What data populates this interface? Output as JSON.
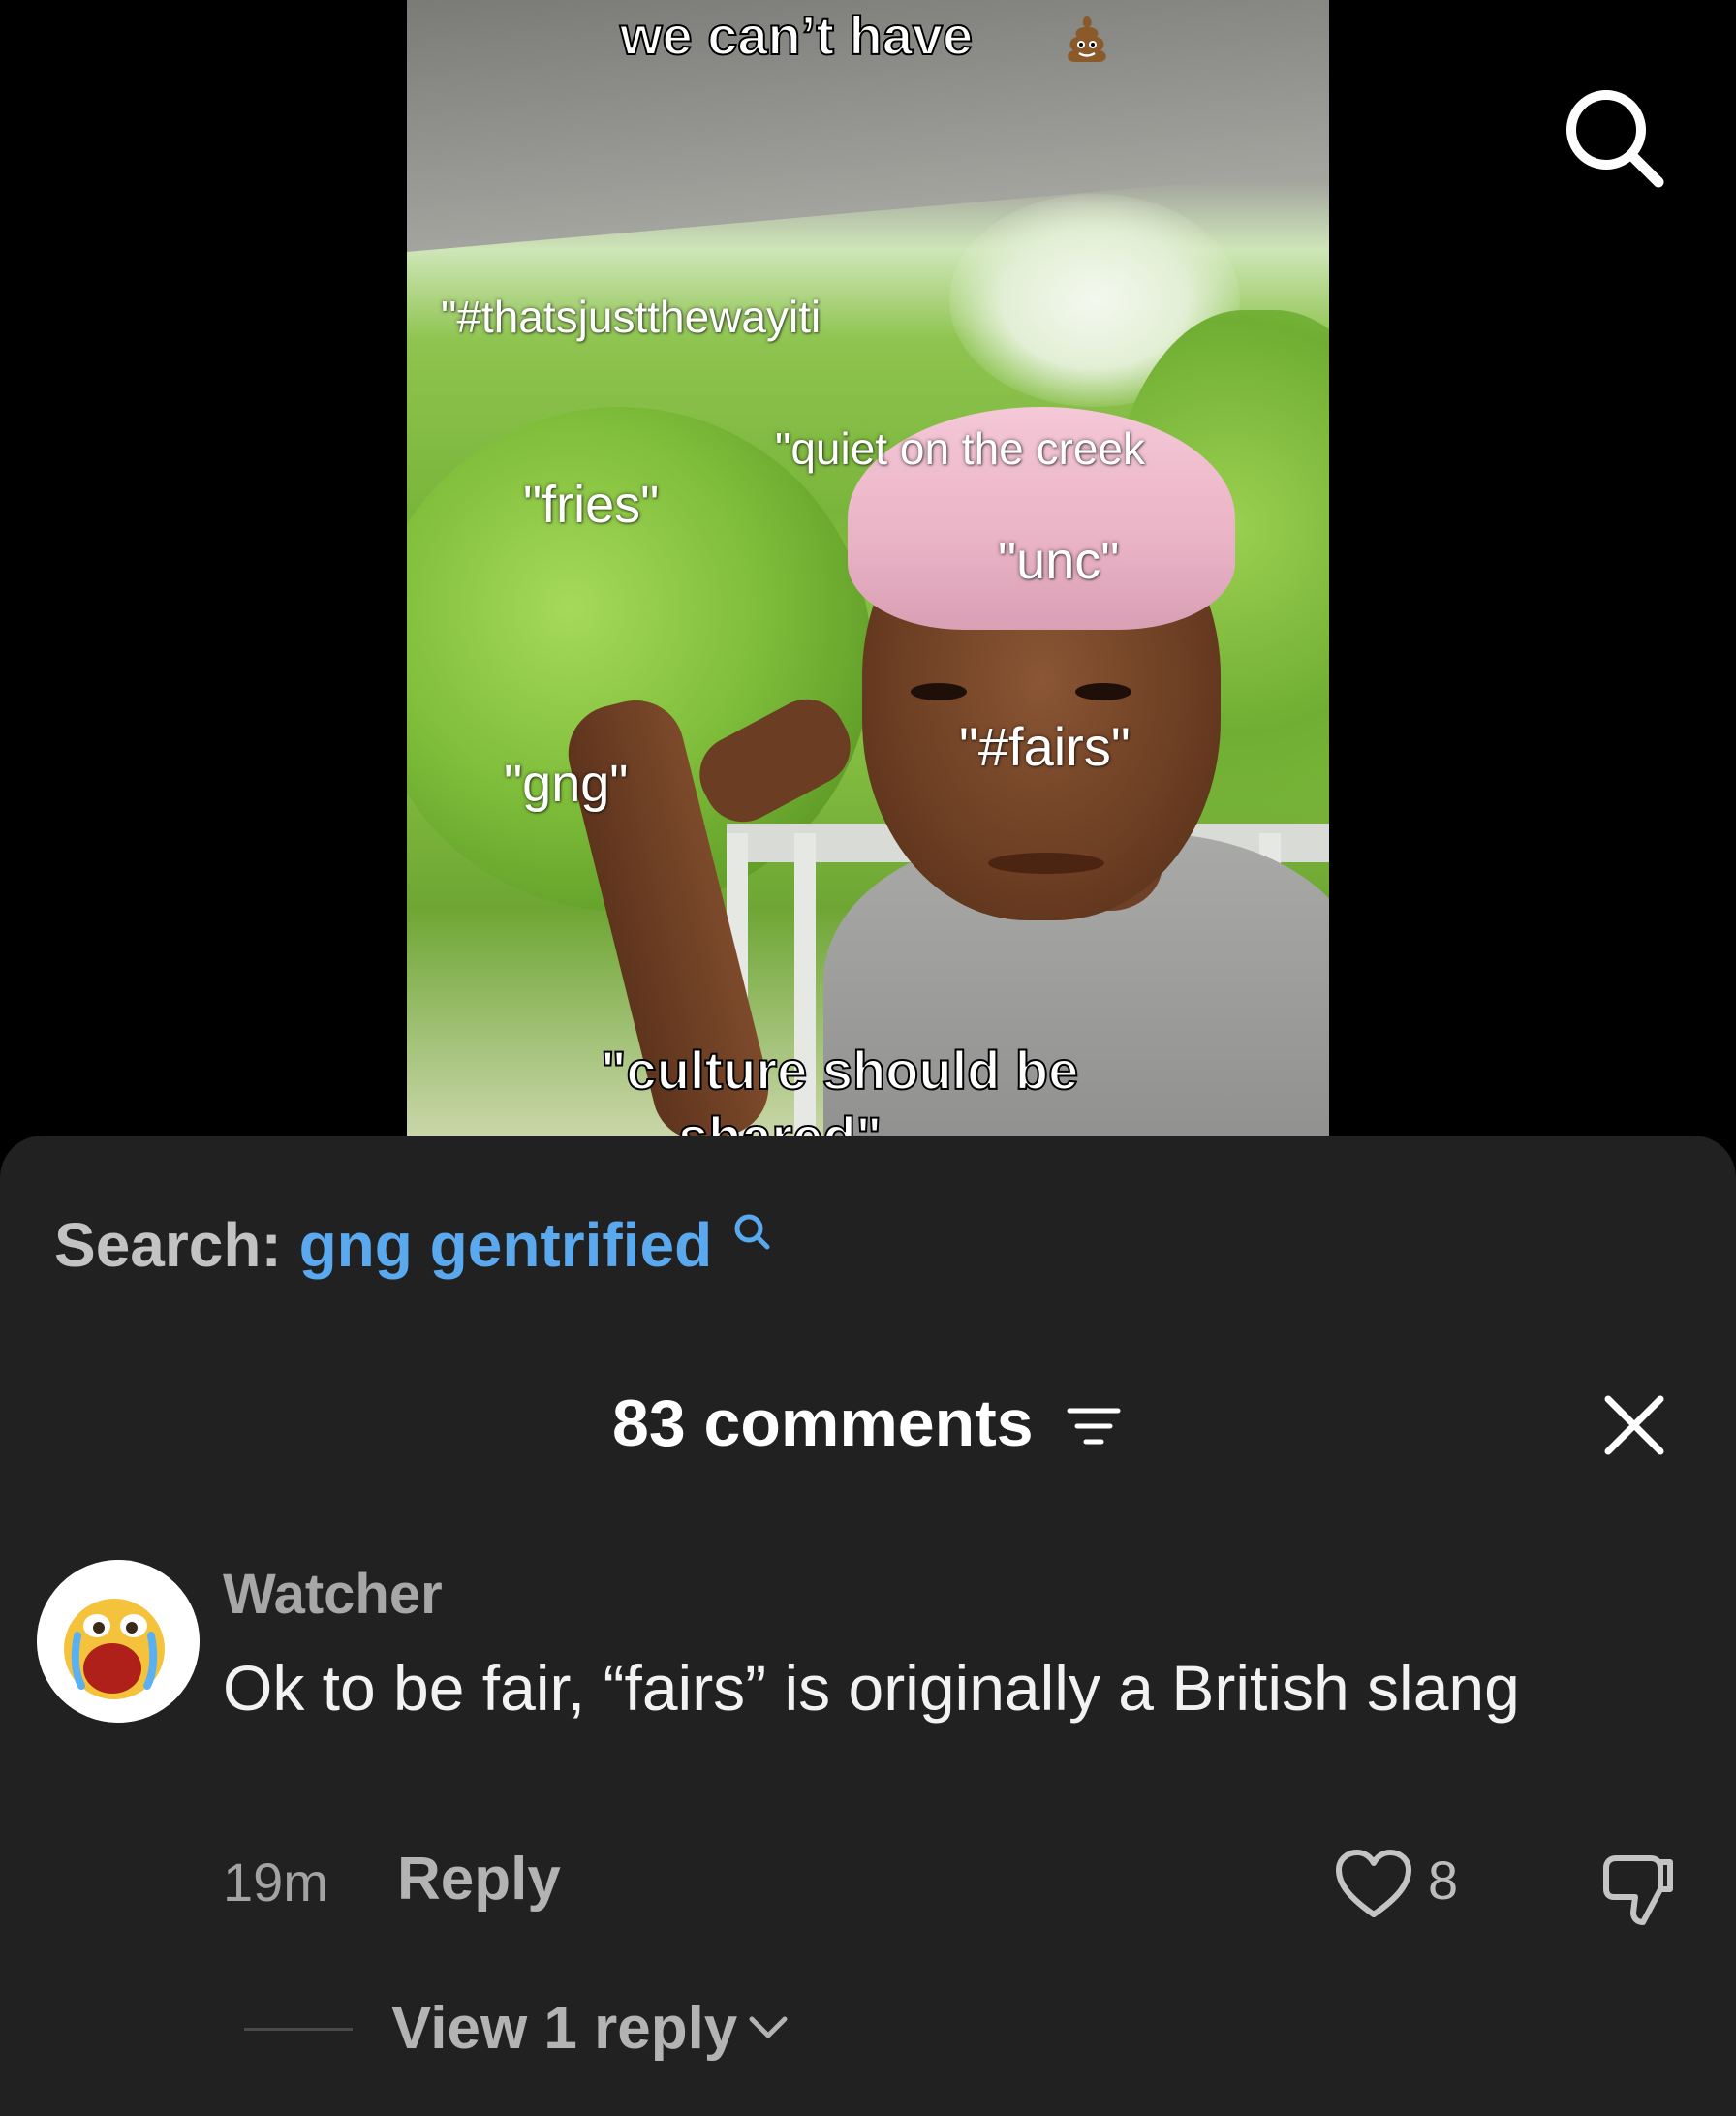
{
  "video": {
    "caption_top": "we can’t have",
    "overlay_words": [
      "\"#thatsjustthewayiti",
      "\"quiet on the creek",
      "\"fries\"",
      "\"unc\"",
      "\"#fairs\"",
      "\"gng\""
    ],
    "caption_bottom_line1": "\"culture should be",
    "caption_bottom_line2": "shared\""
  },
  "top_bar": {
    "search_icon": "search-icon"
  },
  "search_suggestion": {
    "label": "Search:",
    "query": "gng gentrified",
    "icon": "search-icon",
    "accent_color": "#5aa8ee"
  },
  "comments_header": {
    "count_label": "83 comments",
    "sort_icon": "filter-lines-icon",
    "close_icon": "close-icon"
  },
  "comments": [
    {
      "username": "Watcher",
      "avatar_icon": "crying-emoji-avatar",
      "text": "Ok to be fair, “fairs” is originally a British slang",
      "time": "19m",
      "reply_label": "Reply",
      "like_count": "8",
      "like_icon": "heart-icon",
      "dislike_icon": "thumbs-down-icon",
      "view_replies_label": "View 1 reply"
    }
  ],
  "colors": {
    "sheet_background": "#212121",
    "page_background": "#000000"
  }
}
